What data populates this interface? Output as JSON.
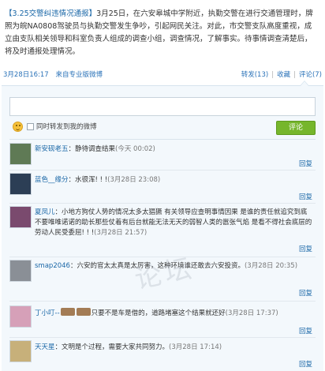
{
  "post": {
    "title": "【3.25交警纠违情况通报】",
    "body": "3月25日，在六安皋城中学附近，执勤交警在进行交通管理时，牌照为皖NA0808驾驶员与执勤交警发生争吵，引起网民关注。对此，市交警支队高度重视，成立由支队相关领导和科室负责人组成的调查小组，调查情况，了解事实。待事情调查清楚后，将及时通报处理情况。"
  },
  "meta": {
    "date": "3月28日16:17",
    "source": "来自专业版微博",
    "repost": "转发(13)",
    "favorite": "收藏",
    "comments": "评论(7)"
  },
  "composer": {
    "input_value": "",
    "emoji_icon": "smiley-icon",
    "checkbox_label": "同时转发到我的微博",
    "submit_label": "评论"
  },
  "watermark": "论坛",
  "comments": [
    {
      "user": "新安砚老五",
      "text": "：静待调查结果",
      "time": "(今天 00:02)",
      "reply": "回复",
      "avatar_color": "#5f7a55"
    },
    {
      "user": "蓝色__缘分",
      "text": "：水很浑! ! !",
      "time": "(3月28日 23:08)",
      "reply": "回复",
      "avatar_color": "#2c3e55"
    },
    {
      "user": "夏凤儿",
      "text": "：小地方狗仗人势的情况太多太猖獗 有关领导应查明事情因果 是谁的责任就追究到底 不要唯唯诺诺的助长那些仗着有后台就能无法无天的弱智人类的嚣张气焰 是看不得社会底层的劳动人民受委屈! ! !",
      "time": "(3月28日 21:57)",
      "reply": "回复",
      "avatar_color": "#7a4a6e"
    },
    {
      "user": "smap2046",
      "text": "：六安的官太太真是太厉害，这种环境谁还敢去六安投资。",
      "time": "(3月28日 20:35)",
      "reply": "回复",
      "avatar_color": "#8a8f96"
    },
    {
      "user": "丁小叮--",
      "text": "只要不是车是借的，道路堵塞这个结果就还好",
      "time": "(3月28日 17:37)",
      "reply": "回复",
      "avatar_color": "#d6a0b8"
    },
    {
      "user": "天天星",
      "text": "：文明是个过程，需要大家共同努力。",
      "time": "(3月28日 17:14)",
      "reply": "回复",
      "avatar_color": "#c7b07a"
    }
  ]
}
